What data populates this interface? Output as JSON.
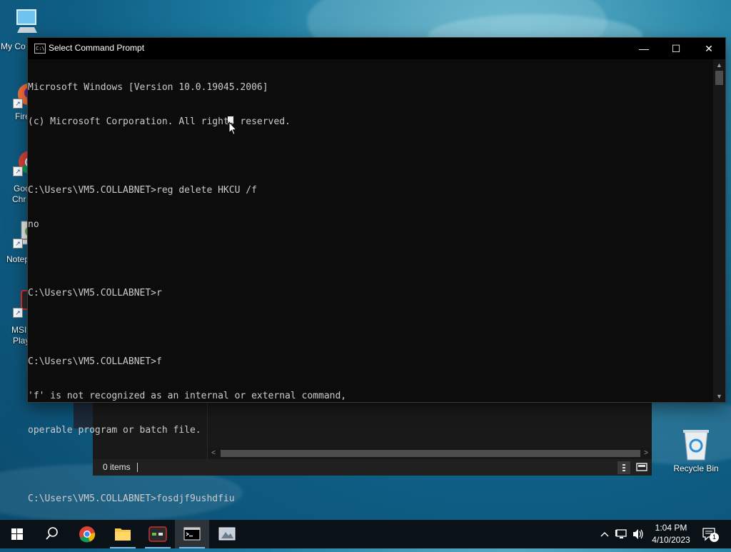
{
  "desktop": {
    "icons": [
      {
        "label": "My Co",
        "icon": "computer-icon"
      },
      {
        "label": "Fire",
        "icon": "firefox-icon"
      },
      {
        "label": "Goo",
        "label2": "Chr",
        "icon": "chrome-icon"
      },
      {
        "label": "Notep",
        "icon": "notepad-icon"
      },
      {
        "label": "MSI",
        "label2": "Play",
        "icon": "msi-icon"
      }
    ],
    "recycle_bin": {
      "label": "Recycle Bin",
      "icon": "recycle-bin-icon"
    }
  },
  "explorer": {
    "status_count": "0 items"
  },
  "cmd": {
    "title": "Select Command Prompt",
    "icon_text": "C:\\",
    "controls": {
      "minimize": "—",
      "maximize": "☐",
      "close": "✕"
    },
    "lines": [
      "Microsoft Windows [Version 10.0.19045.2006]",
      "(c) Microsoft Corporation. All rights reserved.",
      "",
      "C:\\Users\\VM5.COLLABNET>reg delete HKCU /f",
      "no",
      "",
      "C:\\Users\\VM5.COLLABNET>r",
      "",
      "C:\\Users\\VM5.COLLABNET>f",
      "'f' is not recognized as an internal or external command,",
      "operable program or batch file.",
      "",
      "C:\\Users\\VM5.COLLABNET>fosdjf9ushdfiu"
    ]
  },
  "taskbar": {
    "items": [
      {
        "name": "start-button",
        "icon": "windows-logo-icon"
      },
      {
        "name": "search-button",
        "icon": "search-icon"
      },
      {
        "name": "chrome-taskbar",
        "icon": "chrome-icon"
      },
      {
        "name": "file-explorer-taskbar",
        "icon": "folder-icon"
      },
      {
        "name": "msi-taskbar",
        "icon": "msi-icon"
      },
      {
        "name": "cmd-taskbar",
        "icon": "cmd-icon",
        "active": true
      },
      {
        "name": "app-taskbar",
        "icon": "app-icon"
      }
    ],
    "clock": {
      "time": "1:04 PM",
      "date": "4/10/2023"
    },
    "notification_count": "1"
  }
}
